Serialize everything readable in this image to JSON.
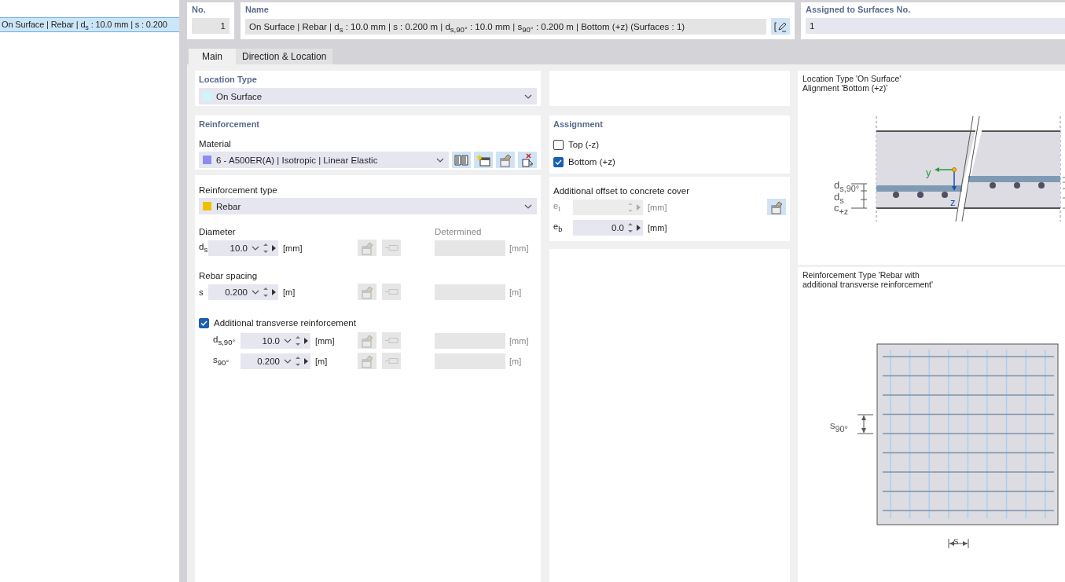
{
  "list": {
    "items": [
      {
        "label": "On Surface | Rebar | d$_{s}$ : 10.0 mm | s : 0.200",
        "selected": true
      }
    ]
  },
  "header": {
    "no": {
      "label": "No.",
      "value": "1"
    },
    "name": {
      "label": "Name",
      "value": "On Surface | Rebar | d$_{s}$ : 10.0 mm | s : 0.200 m | d$_{s,90°}$ : 10.0 mm | s$_{90°}$ : 0.200 m | Bottom (+z) (Surfaces : 1)"
    },
    "assigned": {
      "label": "Assigned to Surfaces No.",
      "value": "1"
    }
  },
  "tabs": [
    {
      "label": "Main",
      "selected": true
    },
    {
      "label": "Direction & Location",
      "selected": false
    }
  ],
  "location_type": {
    "title": "Location Type",
    "value": "On Surface",
    "color": "#ccf6fb"
  },
  "reinforcement": {
    "title": "Reinforcement",
    "material_label": "Material",
    "material": "6 - A500ER(A) | Isotropic | Linear Elastic",
    "color": "#8c8cf0"
  },
  "reinforcement_type": {
    "label": "Reinforcement type",
    "value": "Rebar",
    "color": "#f0c000"
  },
  "parameters": [
    {
      "title": "Diameter",
      "determined_label": "Determined",
      "rows": [
        {
          "symbol": "d$_{s}$",
          "value": "10.0",
          "unit": "[mm]",
          "tools_disabled": true,
          "determined_unit": "[mm]"
        }
      ]
    },
    {
      "title": "Rebar spacing",
      "rows": [
        {
          "symbol": "s",
          "value": "0.200",
          "unit": "[m]",
          "tools_disabled": true,
          "determined_unit": "[m]"
        }
      ]
    }
  ],
  "transverse": {
    "label": "Additional transverse reinforcement",
    "checked": true,
    "rows": [
      {
        "symbol": "d$_{s,90°}$",
        "value": "10.0",
        "unit": "[mm]",
        "tools_disabled": true,
        "determined_unit": "[mm]"
      },
      {
        "symbol": "s$_{90°}$",
        "value": "0.200",
        "unit": "[m]",
        "tools_disabled": true,
        "determined_unit": "[m]"
      }
    ]
  },
  "assignment": {
    "title": "Assignment",
    "options": [
      {
        "label": "Top (-z)",
        "checked": false
      },
      {
        "label": "Bottom (+z)",
        "checked": true
      }
    ]
  },
  "offset": {
    "title": "Additional offset to concrete cover",
    "rows": [
      {
        "symbol": "e$_{t}$",
        "unit": "[mm]",
        "disabled": true
      },
      {
        "symbol": "e$_{b}$",
        "value": "0.0",
        "unit": "[mm]",
        "disabled": false
      }
    ]
  },
  "diagrams": [
    {
      "kind": "section",
      "caption_lines": [
        "Location Type 'On Surface'",
        "Alignment 'Bottom (+z)'"
      ],
      "labels": [
        "d$_{s,90°}$",
        "d$_{s}$",
        "c$_{+z}$",
        "y",
        "z"
      ]
    },
    {
      "kind": "grid",
      "caption_lines": [
        "Reinforcement Type 'Rebar with",
        "additional transverse reinforcement'"
      ],
      "labels": [
        "s$_{90°}$",
        "s"
      ]
    }
  ]
}
